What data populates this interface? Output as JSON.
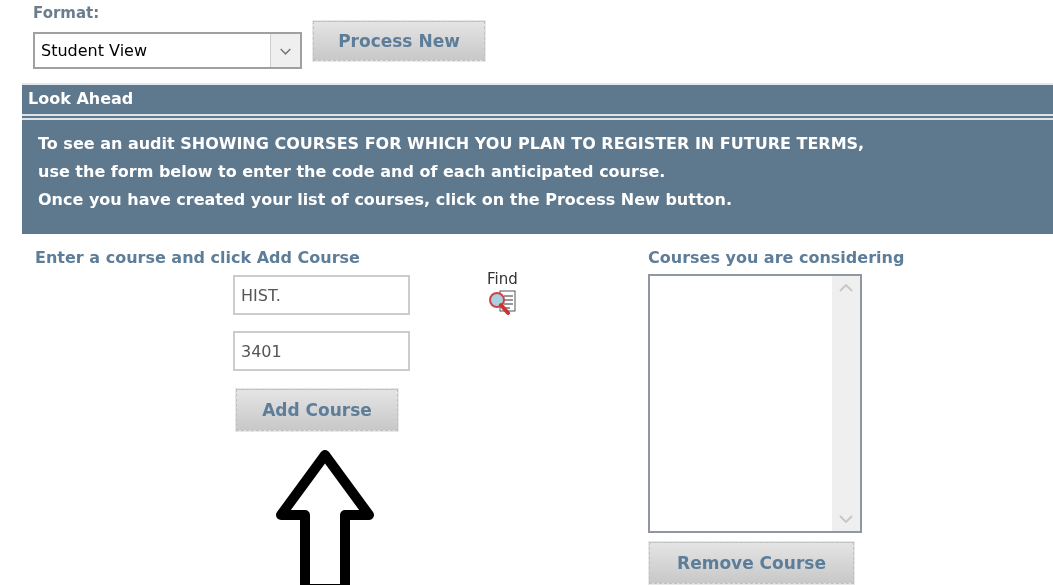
{
  "format": {
    "label": "Format:",
    "value": "Student View"
  },
  "process_button": "Process New",
  "panel": {
    "title": "Look Ahead",
    "lines": [
      "To see an audit SHOWING COURSES FOR WHICH YOU PLAN TO REGISTER IN FUTURE TERMS,",
      "use the form below to enter the code and of each anticipated course.",
      "Once you have created your list of courses, click on the Process New button."
    ]
  },
  "entry": {
    "heading": "Enter a course and click Add Course",
    "subject": "HIST.",
    "number": "3401",
    "find_label": "Find",
    "add_button": "Add Course"
  },
  "considering": {
    "heading": "Courses you are considering",
    "remove_button": "Remove Course"
  }
}
